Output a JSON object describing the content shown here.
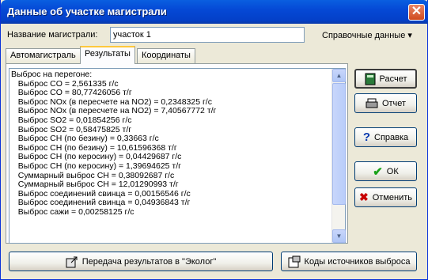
{
  "window": {
    "title": "Данные об участке магистрали",
    "close_glyph": "✕"
  },
  "name_label": "Название магистрали:",
  "name_value": "участок 1",
  "reference_menu": "Справочные данные",
  "tabs": [
    "Автомагистраль",
    "Результаты",
    "Координаты"
  ],
  "results": {
    "text": "Выброс на перегоне:\n   Выброс CO = 2,561335 г/с\n   Выброс CO = 80,77426056 т/г\n   Выброс NOx (в пересчете на NO2) = 0,2348325 г/с\n   Выброс NOx (в пересчете на NO2) = 7,40567772 т/г\n   Выброс SO2 = 0,01854256 г/с\n   Выброс SO2 = 0,58475825 т/г\n   Выброс CH (по безину) = 0,33663 г/с\n   Выброс CH (по безину) = 10,61596368 т/г\n   Выброс CH (по керосину) = 0,04429687 г/с\n   Выброс CH (по керосину) = 1,39694625 т/г\n   Суммарный выброс CH = 0,38092687 г/с\n   Суммарный выброс CH = 12,01290993 т/г\n   Выброс соединений свинца = 0,00156546 г/с\n   Выброс соединений свинца = 0,04936843 т/г\n   Выброс сажи = 0,00258125 г/с"
  },
  "buttons": {
    "calc": "Расчет",
    "report": "Отчет",
    "help": "Справка",
    "ok": "ОК",
    "cancel": "Отменить",
    "transfer": "Передача результатов в \"Эколог\"",
    "codes": "Коды источников выброса"
  }
}
